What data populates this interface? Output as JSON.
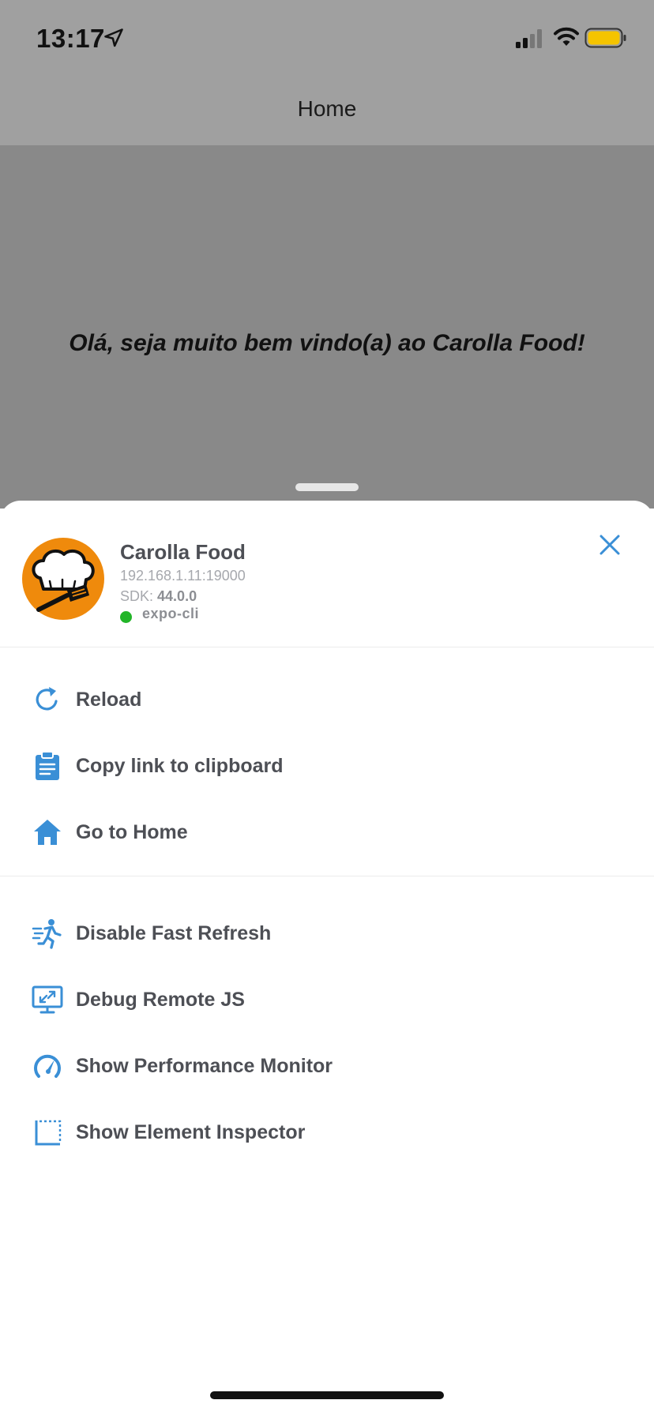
{
  "status_bar": {
    "time": "13:17",
    "icons": [
      "location-arrow-icon",
      "cellular-signal-icon",
      "wifi-icon",
      "battery-icon"
    ],
    "battery_color": "#f5c400"
  },
  "header": {
    "title": "Home"
  },
  "app_content": {
    "welcome_text": "Olá, seja muito bem vindo(a) ao Carolla Food!"
  },
  "dev_menu": {
    "app": {
      "name": "Carolla Food",
      "host": "192.168.1.11:19000",
      "sdk_label": "SDK:",
      "sdk_version": "44.0.0",
      "runtime": "expo-cli",
      "status_color": "#22b528"
    },
    "accent_color": "#3a8fd6",
    "group1": [
      {
        "label": "Reload",
        "icon": "reload-icon"
      },
      {
        "label": "Copy link to clipboard",
        "icon": "clipboard-icon"
      },
      {
        "label": "Go to Home",
        "icon": "home-icon"
      }
    ],
    "group2": [
      {
        "label": "Disable Fast Refresh",
        "icon": "running-person-icon"
      },
      {
        "label": "Debug Remote JS",
        "icon": "remote-debug-icon"
      },
      {
        "label": "Show Performance Monitor",
        "icon": "speedometer-icon"
      },
      {
        "label": "Show Element Inspector",
        "icon": "inspector-icon"
      }
    ]
  }
}
